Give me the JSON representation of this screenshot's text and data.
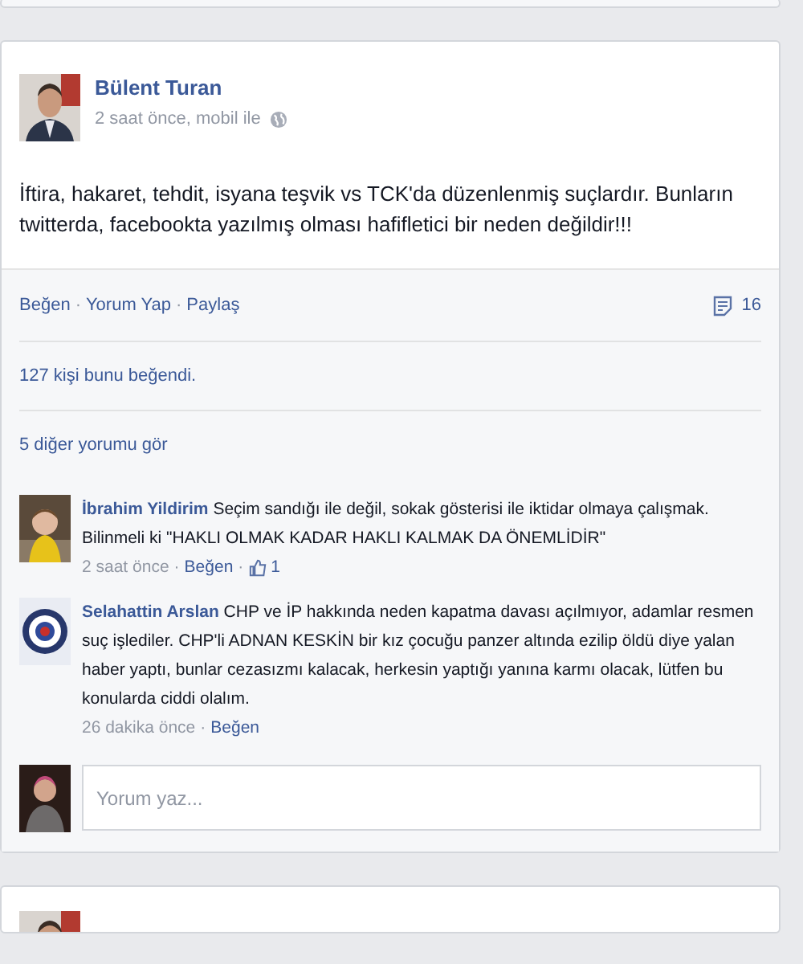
{
  "post": {
    "separator": "·",
    "author": "Bülent Turan",
    "meta": "2 saat önce, mobil ile",
    "text": "İftira, hakaret, tehdit, isyana teşvik vs TCK'da düzenlenmiş suçlardır. Bunların twitterda, facebookta yazılmış olması hafifletici bir neden değildir!!!",
    "actions": [
      "Beğen",
      "Yorum Yap",
      "Paylaş"
    ],
    "share_count": "16",
    "likes": "127 kişi bunu beğendi.",
    "more_comments": "5 diğer yorumu gör",
    "comments": [
      {
        "author": "İbrahim Yildirim",
        "text": "Seçim sandığı ile değil, sokak gösterisi ile iktidar olmaya çalışmak. Bilinmeli ki \"HAKLI OLMAK KADAR HAKLI KALMAK DA ÖNEMLİDİR\"",
        "time": "2 saat önce",
        "action": "Beğen",
        "like_count": "1"
      },
      {
        "author": "Selahattin Arslan",
        "text": "CHP ve İP hakkında neden kapatma davası açılmıyor, adamlar resmen suç işlediler. CHP'li ADNAN KESKİN bir kız çocuğu panzer altında ezilip öldü diye yalan haber yaptı, bunlar cezasızmı kalacak, herkesin yaptığı yanına karmı olacak, lütfen bu konularda ciddi olalım.",
        "time": "26 dakika önce",
        "action": "Beğen"
      }
    ],
    "comment_box": {
      "placeholder": "Yorum yaz..."
    }
  }
}
